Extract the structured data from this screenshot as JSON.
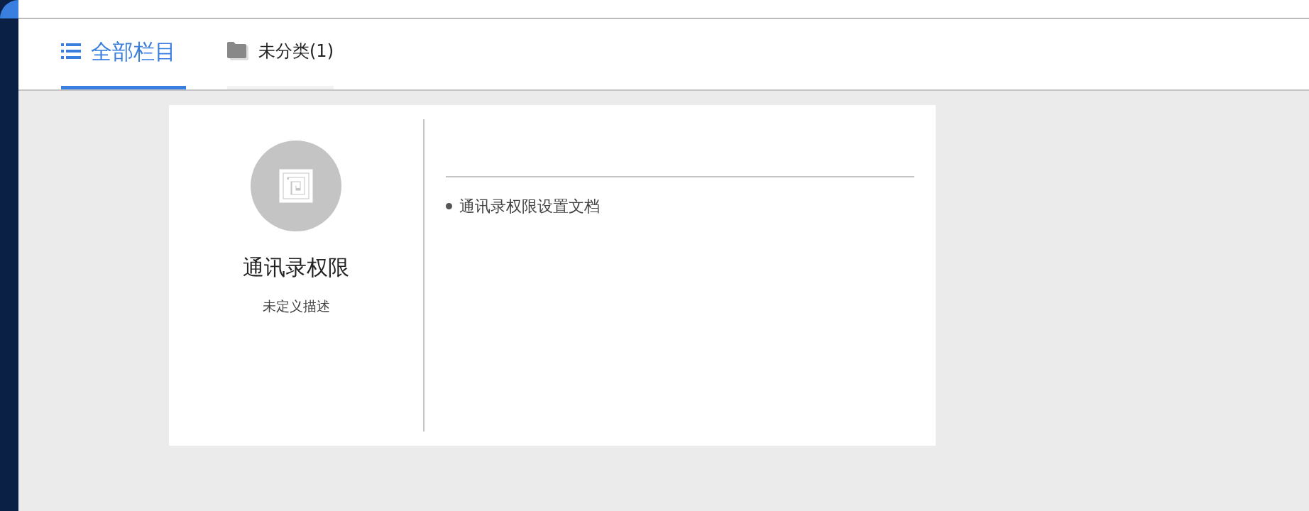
{
  "tabs": [
    {
      "label": "全部栏目",
      "selected": true,
      "kind": "list"
    },
    {
      "label": "未分类(1)",
      "selected": false,
      "kind": "folder"
    }
  ],
  "category": {
    "title": "通讯录权限",
    "description": "未定义描述",
    "documents": [
      "通讯录权限设置文档"
    ]
  }
}
